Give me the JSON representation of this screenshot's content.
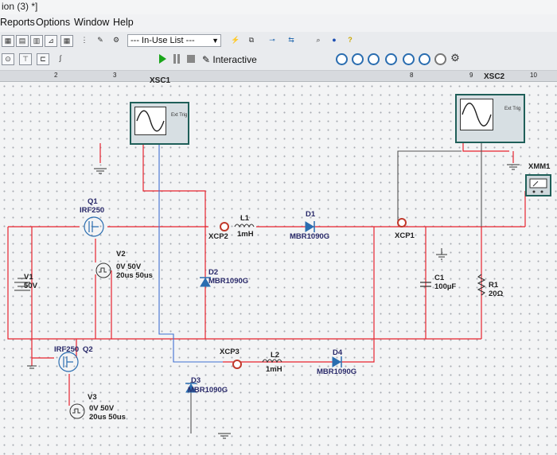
{
  "window": {
    "title": "ion (3) *]"
  },
  "menu": {
    "items": [
      "Reports",
      "Options",
      "Window",
      "Help"
    ]
  },
  "toolbar": {
    "in_use_list": "--- In-Use List ---",
    "interactive_label": "Interactive"
  },
  "ruler": {
    "marks": [
      "2",
      "3",
      "8",
      "9",
      "10"
    ]
  },
  "instruments": {
    "xsc1": "XSC1",
    "xsc2": "XSC2",
    "xmm1": "XMM1",
    "ext_trig": "Ext Trig"
  },
  "components": {
    "q1": {
      "ref": "Q1",
      "model": "IRF250"
    },
    "q2": {
      "model": "IRF250",
      "ref": "Q2"
    },
    "v1": {
      "ref": "V1",
      "value": "50V"
    },
    "v2": {
      "ref": "V2",
      "line1": "0V 50V",
      "line2": "20us 50us"
    },
    "v3": {
      "ref": "V3",
      "line1": "0V 50V",
      "line2": "20us 50us"
    },
    "l1": {
      "ref": "L1",
      "value": "1mH"
    },
    "l2": {
      "ref": "L2",
      "value": "1mH"
    },
    "d1": {
      "ref": "D1",
      "model": "MBR1090G"
    },
    "d2": {
      "ref": "D2",
      "model": "MBR1090G"
    },
    "d3": {
      "ref": "D3",
      "model": "MBR1090G"
    },
    "d4": {
      "ref": "D4",
      "model": "MBR1090G"
    },
    "c1": {
      "ref": "C1",
      "value": "100µF"
    },
    "r1": {
      "ref": "R1",
      "value": "20Ω"
    },
    "xcp1": "XCP1",
    "xcp2": "XCP2",
    "xcp3": "XCP3"
  },
  "colors": {
    "wire_red": "#e8232e",
    "wire_gray": "#555555",
    "wire_blue": "#3f6fd1",
    "scope_frame": "#1f5f59",
    "probe": "#c0392b",
    "play": "#1aa51a"
  }
}
